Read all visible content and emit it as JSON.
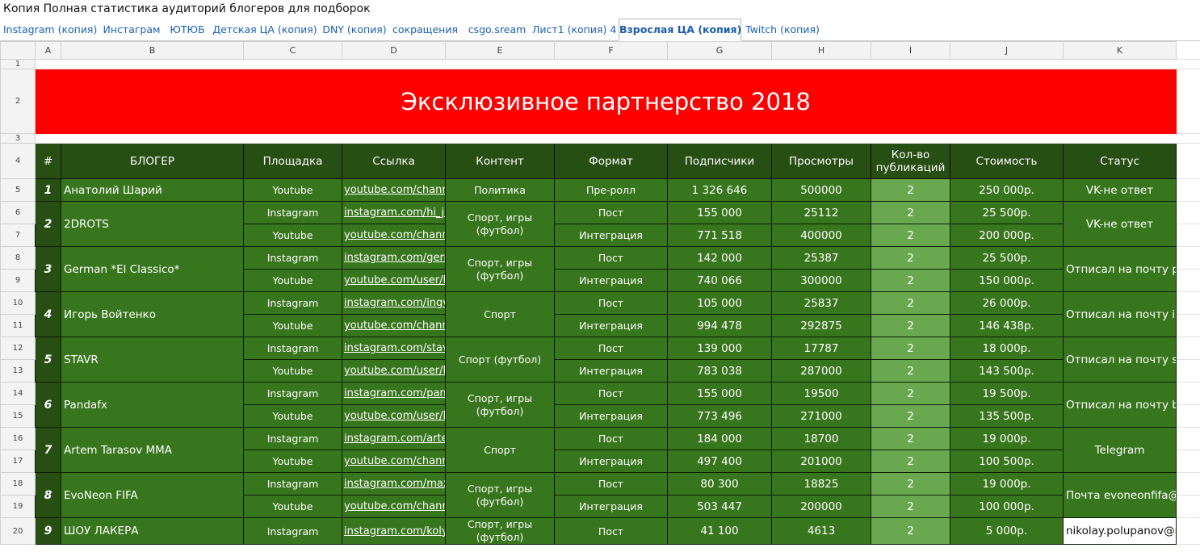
{
  "document_title": "Копия Полная статистика аудиторий блогеров для подборок",
  "tabs": [
    {
      "label": "Instagram (копия)",
      "active": false
    },
    {
      "label": "Инстаграм",
      "active": false
    },
    {
      "label": "ЮТЮБ",
      "active": false
    },
    {
      "label": "Детская ЦА (копия)",
      "active": false
    },
    {
      "label": "DNY (копия)",
      "active": false
    },
    {
      "label": "сокращения",
      "active": false
    },
    {
      "label": "csgo.sream",
      "active": false
    },
    {
      "label": "Лист1 (копия) 4",
      "active": false
    },
    {
      "label": "Взрослая ЦА (копия)",
      "active": true
    },
    {
      "label": "Twitch (копия)",
      "active": false
    }
  ],
  "column_letters": [
    "A",
    "B",
    "C",
    "D",
    "E",
    "F",
    "G",
    "H",
    "I",
    "J",
    "K"
  ],
  "row_numbers": [
    "1",
    "2",
    "3",
    "4",
    "5",
    "6",
    "7",
    "8",
    "9",
    "10",
    "11",
    "12",
    "13",
    "14",
    "15",
    "16",
    "17",
    "18",
    "19",
    "20"
  ],
  "banner_title": "Эксклюзивное партнерство 2018",
  "headers": [
    "#",
    "БЛОГЕР",
    "Площадка",
    "Ссылка",
    "Контент",
    "Формат",
    "Подписчики",
    "Просмотры",
    "Кол-во публикаций",
    "Стоимость",
    "Статус"
  ],
  "bloggers": [
    {
      "num": "1",
      "name": "Анатолий Шарий",
      "content": "Политика",
      "status": "VK-не ответ",
      "rows": [
        {
          "platform": "Youtube",
          "link": "youtube.com/channel",
          "format": "Пре-ролл",
          "subscribers": "1 326 646",
          "views": "500000",
          "count": "2",
          "price": "250 000р."
        }
      ]
    },
    {
      "num": "2",
      "name": "2DROTS",
      "content": "Спорт, игры (футбол)",
      "status": "VK-не ответ",
      "rows": [
        {
          "platform": "Instagram",
          "link": "instagram.com/hi_je",
          "format": "Пост",
          "subscribers": "155 000",
          "views": "25112",
          "count": "2",
          "price": "25 500р."
        },
        {
          "platform": "Youtube",
          "link": "youtube.com/channel",
          "format": "Интеграция",
          "subscribers": "771 518",
          "views": "400000",
          "count": "2",
          "price": "200 000р."
        }
      ]
    },
    {
      "num": "3",
      "name": "German *El Classico*",
      "content": "Спорт, игры (футбол)",
      "status": "Отписал на почту ро",
      "rows": [
        {
          "platform": "Instagram",
          "link": "instagram.com/germ",
          "format": "Пост",
          "subscribers": "142 000",
          "views": "25387",
          "count": "2",
          "price": "25 500р."
        },
        {
          "platform": "Youtube",
          "link": "youtube.com/user/E",
          "format": "Интеграция",
          "subscribers": "740 066",
          "views": "300000",
          "count": "2",
          "price": "150 000р."
        }
      ]
    },
    {
      "num": "4",
      "name": "Игорь Войтенко",
      "content": "Спорт",
      "status": "Отписал на почту ih",
      "rows": [
        {
          "platform": "Instagram",
          "link": "instagram.com/ingva",
          "format": "Пост",
          "subscribers": "105 000",
          "views": "25837",
          "count": "2",
          "price": "26 000р."
        },
        {
          "platform": "Youtube",
          "link": "youtube.com/channel",
          "format": "Интеграция",
          "subscribers": "994 478",
          "views": "292875",
          "count": "2",
          "price": "146 438р."
        }
      ]
    },
    {
      "num": "5",
      "name": "STAVR",
      "content": "Спорт (футбол)",
      "status": "Отписал на почту st",
      "rows": [
        {
          "platform": "Instagram",
          "link": "instagram.com/stavr",
          "format": "Пост",
          "subscribers": "139 000",
          "views": "17787",
          "count": "2",
          "price": "18 000р."
        },
        {
          "platform": "Youtube",
          "link": "youtube.com/user/P",
          "format": "Интеграция",
          "subscribers": "783 038",
          "views": "287000",
          "count": "2",
          "price": "143 500р."
        }
      ]
    },
    {
      "num": "6",
      "name": "Pandafx",
      "content": "Спорт, игры (футбол)",
      "status": "Отписал на почту br",
      "rows": [
        {
          "platform": "Instagram",
          "link": "instagram.com/pand",
          "format": "Пост",
          "subscribers": "155 000",
          "views": "19500",
          "count": "2",
          "price": "19 500р."
        },
        {
          "platform": "Youtube",
          "link": "youtube.com/user/D",
          "format": "Интеграция",
          "subscribers": "773 496",
          "views": "271000",
          "count": "2",
          "price": "135 500р."
        }
      ]
    },
    {
      "num": "7",
      "name": "Artem Tarasov MMA",
      "content": "Спорт",
      "status": "Telegram",
      "rows": [
        {
          "platform": "Instagram",
          "link": "instagram.com/arter",
          "format": "Пост",
          "subscribers": "184 000",
          "views": "18700",
          "count": "2",
          "price": "19 000р."
        },
        {
          "platform": "Youtube",
          "link": "youtube.com/channel",
          "format": "Интеграция",
          "subscribers": "497 400",
          "views": "201000",
          "count": "2",
          "price": "100 500р."
        }
      ]
    },
    {
      "num": "8",
      "name": "EvoNeon FIFA",
      "content": "Спорт, игры (футбол)",
      "status": "Почта evoneonfifa@g",
      "rows": [
        {
          "platform": "Instagram",
          "link": "instagram.com/maxa",
          "format": "Пост",
          "subscribers": "80 300",
          "views": "18825",
          "count": "2",
          "price": "19 000р."
        },
        {
          "platform": "Youtube",
          "link": "youtube.com/channel",
          "format": "Интеграция",
          "subscribers": "503 447",
          "views": "200000",
          "count": "2",
          "price": "100 000р."
        }
      ]
    },
    {
      "num": "9",
      "name": "ШОУ ЛАКЕРА",
      "content": "Спорт, игры (футбол)",
      "status": "nikolay.polupanov@mail.r",
      "rows": [
        {
          "platform": "Instagram",
          "link": "instagram.com/kolya",
          "format": "Пост",
          "subscribers": "41 100",
          "views": "4613",
          "count": "2",
          "price": "5 000р."
        },
        {
          "platform": "",
          "link": "",
          "format": "",
          "subscribers": "",
          "views": "",
          "count": "",
          "price": ""
        }
      ]
    }
  ],
  "colors": {
    "banner": "#ff0000",
    "header_bg": "#274e13",
    "row_bg": "#38761d",
    "count_bg": "#6aa84f",
    "tab_text": "#1a5fb4"
  }
}
